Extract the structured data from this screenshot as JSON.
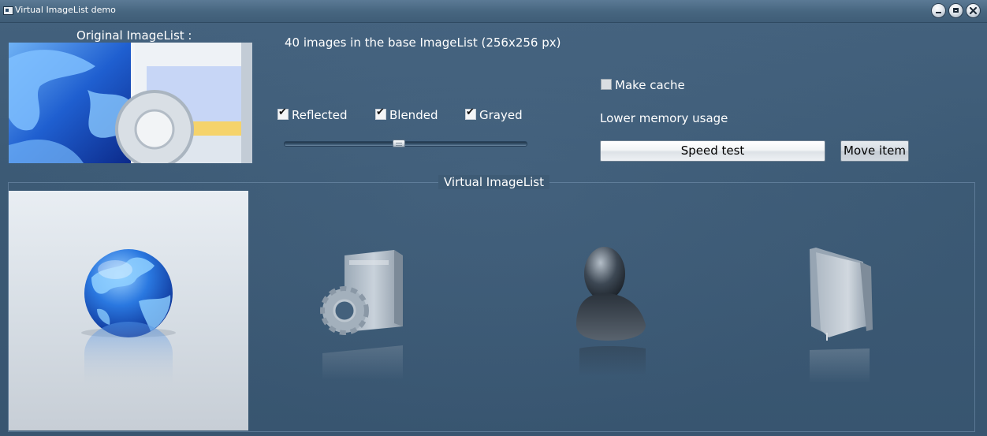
{
  "window": {
    "title": "Virtual ImageList demo"
  },
  "original_imagelist": {
    "label": "Original ImageList :"
  },
  "info": {
    "text": "40 images in the base ImageList (256x256 px)"
  },
  "options": {
    "reflected": {
      "label": "Reflected",
      "checked": true
    },
    "blended": {
      "label": "Blended",
      "checked": true
    },
    "grayed": {
      "label": "Grayed",
      "checked": true
    },
    "make_cache": {
      "label": "Make cache",
      "checked": false
    },
    "slider_value": 0.47
  },
  "memory_label": "Lower memory usage",
  "buttons": {
    "speed_test": "Speed test",
    "move_item": "Move item"
  },
  "virtual_imagelist": {
    "title": "Virtual ImageList",
    "items": [
      {
        "icon": "globe-icon"
      },
      {
        "icon": "settings-box-icon"
      },
      {
        "icon": "user-icon"
      },
      {
        "icon": "folder-icon"
      }
    ]
  },
  "colors": {
    "background": "#3d5a74",
    "text": "#ffffff"
  }
}
